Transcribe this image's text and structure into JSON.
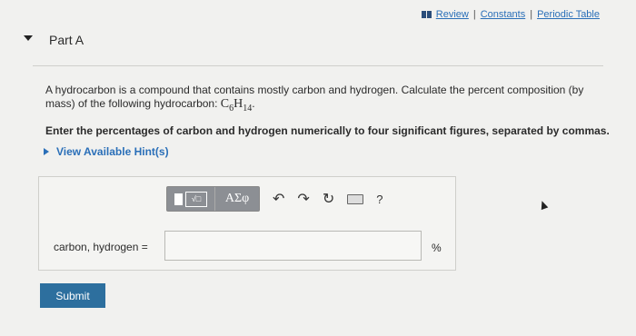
{
  "header": {
    "links": [
      {
        "label": "Review"
      },
      {
        "label": "Constants"
      },
      {
        "label": "Periodic Table"
      }
    ],
    "separator": "|"
  },
  "part": {
    "title": "Part A"
  },
  "question": {
    "text": "A hydrocarbon is a compound that contains mostly carbon and hydrogen. Calculate the percent composition (by mass) of the following hydrocarbon:",
    "formula": {
      "c": "C",
      "c_sub": "6",
      "h": "H",
      "h_sub": "14"
    },
    "instruction": "Enter the percentages of carbon and hydrogen numerically to four significant figures, separated by commas.",
    "hint_label": "View Available Hint(s)"
  },
  "toolbar": {
    "templates_glyph": "√□",
    "symbols_label": "ΑΣφ",
    "help_label": "?"
  },
  "answer": {
    "label": "carbon, hydrogen =",
    "value": "",
    "unit": "%"
  },
  "submit_label": "Submit"
}
